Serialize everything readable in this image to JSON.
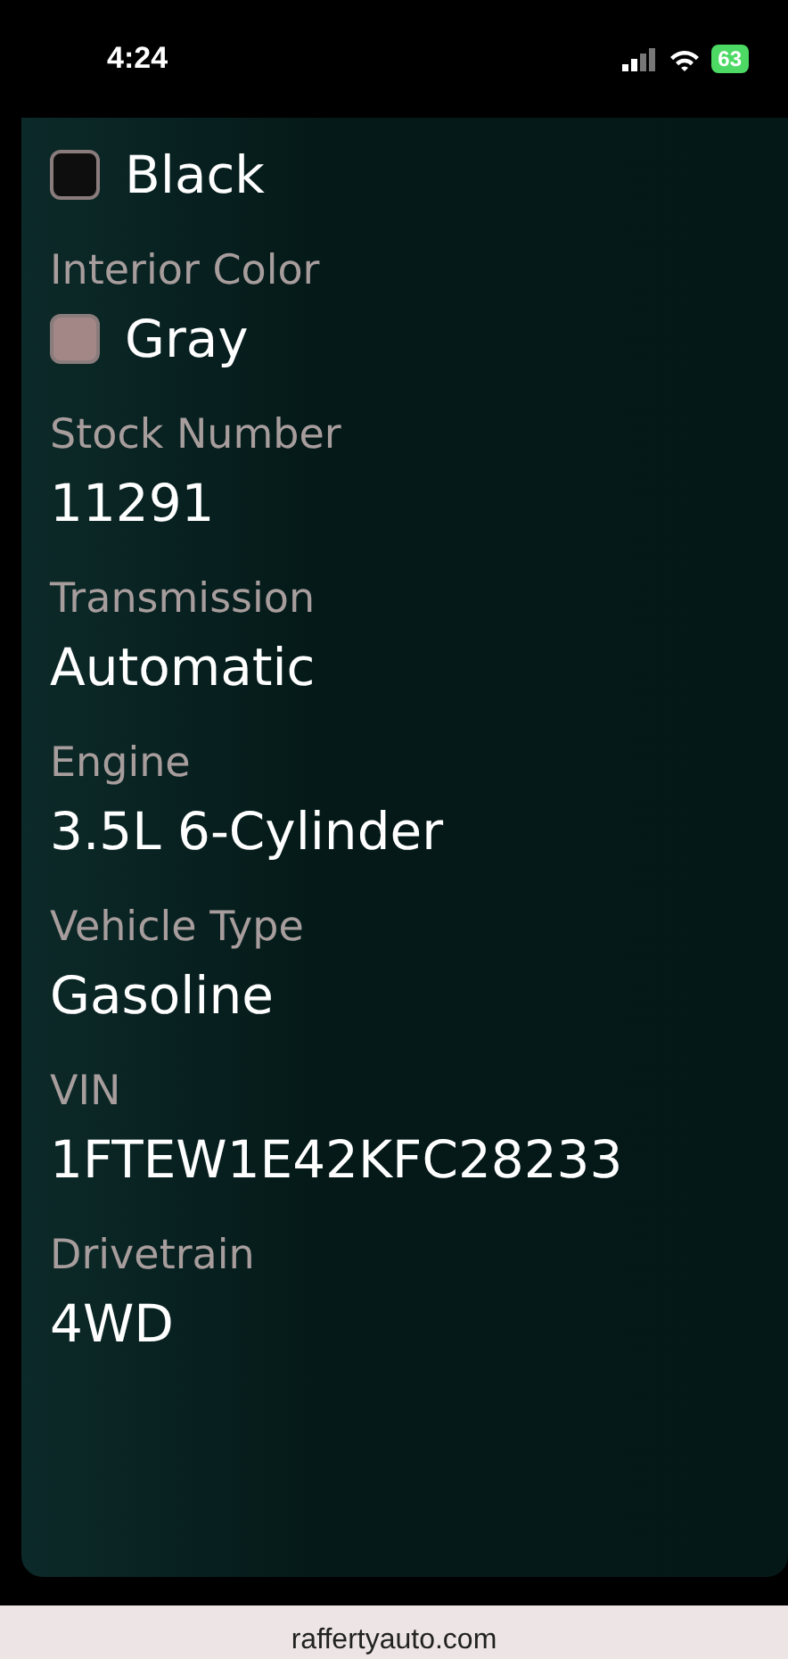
{
  "status_bar": {
    "time": "4:24",
    "battery": "63"
  },
  "fields": [
    {
      "kind": "swatch",
      "value": "Black",
      "color": "#0e0e0e"
    },
    {
      "kind": "swatch",
      "label": "Interior Color",
      "value": "Gray",
      "color": "#a38787"
    },
    {
      "kind": "text",
      "label": "Stock Number",
      "value": "11291"
    },
    {
      "kind": "text",
      "label": "Transmission",
      "value": "Automatic"
    },
    {
      "kind": "text",
      "label": "Engine",
      "value": "3.5L 6-Cylinder"
    },
    {
      "kind": "text",
      "label": "Vehicle Type",
      "value": "Gasoline"
    },
    {
      "kind": "text",
      "label": "VIN",
      "value": "1FTEW1E42KFC28233"
    },
    {
      "kind": "text",
      "label": "Drivetrain",
      "value": "4WD"
    }
  ],
  "address_bar": {
    "url": "raffertyauto.com"
  }
}
